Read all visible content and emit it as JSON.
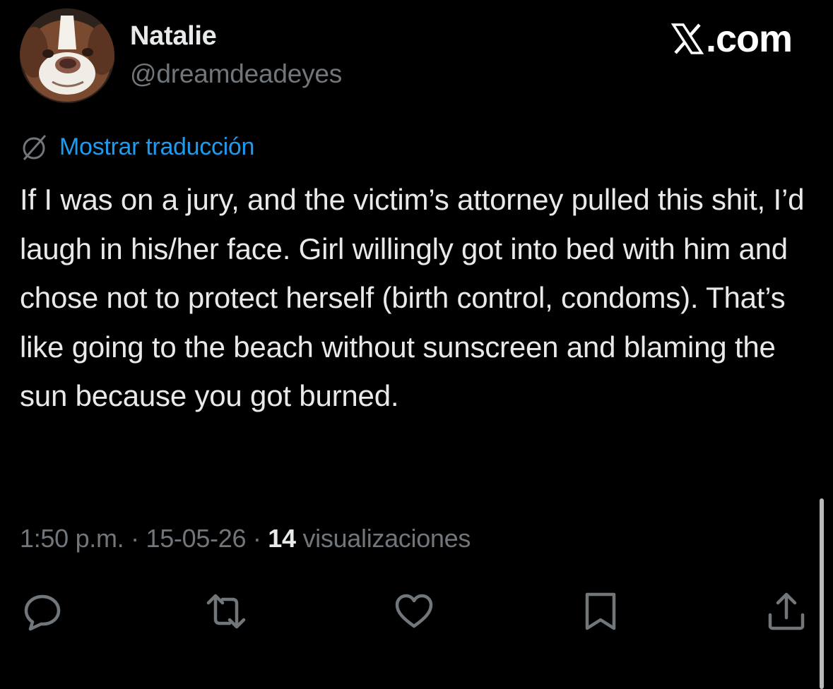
{
  "author": {
    "display_name": "Natalie",
    "handle": "@dreamdeadeyes",
    "avatar_icon": "dog-avatar"
  },
  "brand": {
    "label": ".com",
    "icon": "x-logo-icon"
  },
  "translate": {
    "label": "Mostrar traducción",
    "icon": "globe-slash-icon"
  },
  "tweet": {
    "text": "If I was on a jury, and the victim’s attorney pulled this shit, I’d laugh in his/her face. Girl willingly got into bed with him and chose not to protect herself (birth control, condoms). That’s like going to the beach without sunscreen and blaming the sun because you got burned."
  },
  "meta": {
    "time": "1:50 p.m.",
    "separator": " · ",
    "date": "15-05-26",
    "views_count": "14",
    "views_label": " visualizaciones"
  },
  "actions": [
    {
      "name": "reply",
      "icon": "reply-icon"
    },
    {
      "name": "repost",
      "icon": "repost-icon"
    },
    {
      "name": "like",
      "icon": "heart-icon"
    },
    {
      "name": "bookmark",
      "icon": "bookmark-icon"
    },
    {
      "name": "share",
      "icon": "share-icon"
    }
  ],
  "colors": {
    "background": "#000000",
    "text_primary": "#e7e9ea",
    "text_secondary": "#71767b",
    "link": "#1d9bf0"
  }
}
